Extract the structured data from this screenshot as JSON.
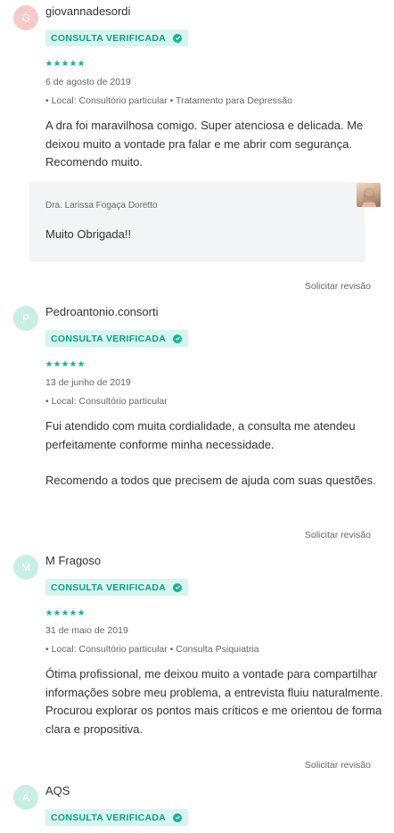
{
  "reviews": [
    {
      "avatar_letter": "G",
      "avatar_color": "#f7c9c9",
      "username": "giovannadesordi",
      "badge": "CONSULTA VERIFICADA",
      "rating": 5,
      "date": "6 de agosto de 2019",
      "meta": "• Local: Consultório particular • Tratamento para Depressão",
      "comment": [
        "A dra foi maravilhosa comigo. Super atenciosa e delicada. Me deixou muito a vontade pra falar e me abrir com segurança. Recomendo muito."
      ],
      "reply": {
        "author": "Dra. Larissa Fogaça Doretto",
        "text": "Muito Obrigada!!"
      },
      "revision_label": "Solicitar revisão"
    },
    {
      "avatar_letter": "P",
      "avatar_color": "#c7efe4",
      "username": "Pedroantonio.consorti",
      "badge": "CONSULTA VERIFICADA",
      "rating": 5,
      "date": "13 de junho de 2019",
      "meta": "• Local: Consultório particular",
      "comment": [
        "Fui atendido com muita cordialidade, a consulta me atendeu perfeitamente conforme minha necessidade.",
        "Recomendo a todos que precisem de ajuda com suas questões."
      ],
      "revision_label": "Solicitar revisão"
    },
    {
      "avatar_letter": "M",
      "avatar_color": "#c7efe4",
      "username": "M Fragoso",
      "badge": "CONSULTA VERIFICADA",
      "rating": 5,
      "date": "31 de maio de 2019",
      "meta": "• Local: Consultório particular • Consulta Psiquiatria",
      "comment": [
        "Ótima profissional, me deixou muito a vontade para compartilhar informações sobre meu problema, a entrevista fluiu naturalmente. Procurou explorar os pontos mais críticos e me orientou de forma clara e propositiva."
      ],
      "revision_label": "Solicitar revisão"
    },
    {
      "avatar_letter": "A",
      "avatar_color": "#c7efe4",
      "username": "AQS",
      "badge": "CONSULTA VERIFICADA"
    }
  ],
  "colors": {
    "accent": "#14b594",
    "badge_bg": "#d7f5ef",
    "badge_text": "#0c9f82"
  }
}
